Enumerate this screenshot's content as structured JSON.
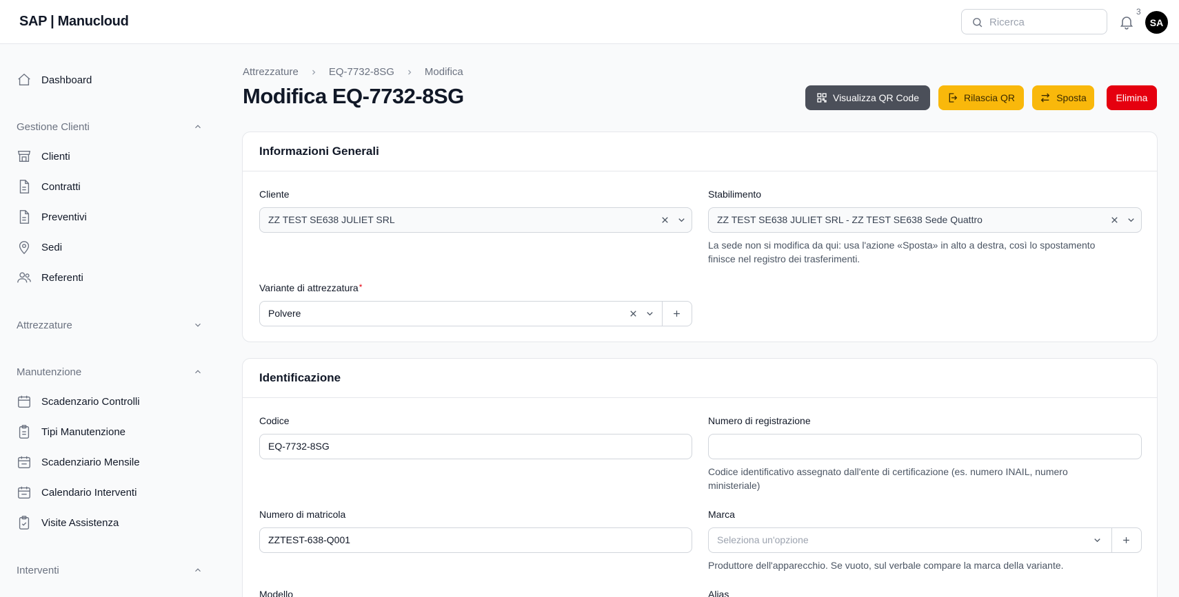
{
  "app": {
    "brand": "SAP | Manucloud"
  },
  "header": {
    "search_placeholder": "Ricerca",
    "notifications_count": "3",
    "avatar_initials": "SA"
  },
  "sidebar": {
    "dashboard": "Dashboard",
    "groups": {
      "gestione_clienti": "Gestione Clienti",
      "attrezzature": "Attrezzature",
      "manutenzione": "Manutenzione",
      "interventi": "Interventi"
    },
    "gestione_clienti_items": [
      "Clienti",
      "Contratti",
      "Preventivi",
      "Sedi",
      "Referenti"
    ],
    "manutenzione_items": [
      "Scadenzario Controlli",
      "Tipi Manutenzione",
      "Scadenziario Mensile",
      "Calendario Interventi",
      "Visite Assistenza"
    ]
  },
  "breadcrumb": [
    "Attrezzature",
    "EQ-7732-8SG",
    "Modifica"
  ],
  "page": {
    "title": "Modifica EQ-7732-8SG",
    "actions": {
      "qr": "Visualizza QR Code",
      "rilascia": "Rilascia QR",
      "sposta": "Sposta",
      "elimina": "Elimina"
    }
  },
  "general": {
    "title": "Informazioni Generali",
    "cliente_label": "Cliente",
    "cliente_value": "ZZ TEST SE638 JULIET SRL",
    "stabilimento_label": "Stabilimento",
    "stabilimento_value": "ZZ TEST SE638 JULIET SRL - ZZ TEST SE638 Sede Quattro",
    "stabilimento_hint_1": "La sede non si modifica da qui: usa l'azione «Sposta» in alto a destra, così lo spostamento",
    "stabilimento_hint_2": "finisce nel registro dei trasferimenti.",
    "variante_label": "Variante di attrezzatura",
    "variante_required": "*",
    "variante_value": "Polvere"
  },
  "identification": {
    "title": "Identificazione",
    "codice_label": "Codice",
    "codice_value": "EQ-7732-8SG",
    "registrazione_label": "Numero di registrazione",
    "registrazione_value": "",
    "registrazione_hint_1": "Codice identificativo assegnato dall'ente di certificazione (es. numero INAIL, numero",
    "registrazione_hint_2": "ministeriale)",
    "matricola_label": "Numero di matricola",
    "matricola_value": "ZZTEST-638-Q001",
    "marca_label": "Marca",
    "marca_placeholder": "Seleziona un'opzione",
    "marca_hint": "Produttore dell'apparecchio. Se vuoto, sul verbale compare la marca della variante.",
    "modello_label": "Modello",
    "alias_label": "Alias"
  },
  "icons": {
    "search": "search-icon",
    "bell": "bell-icon",
    "home": "home-icon",
    "store": "store-icon",
    "document": "document-icon",
    "location": "location-icon",
    "users": "users-icon",
    "calendar": "calendar-icon",
    "clipboard": "clipboard-icon"
  },
  "colors": {
    "qr_button": "#4b4f59",
    "warning_button": "#f9b80b",
    "danger_button": "#e5000f"
  }
}
